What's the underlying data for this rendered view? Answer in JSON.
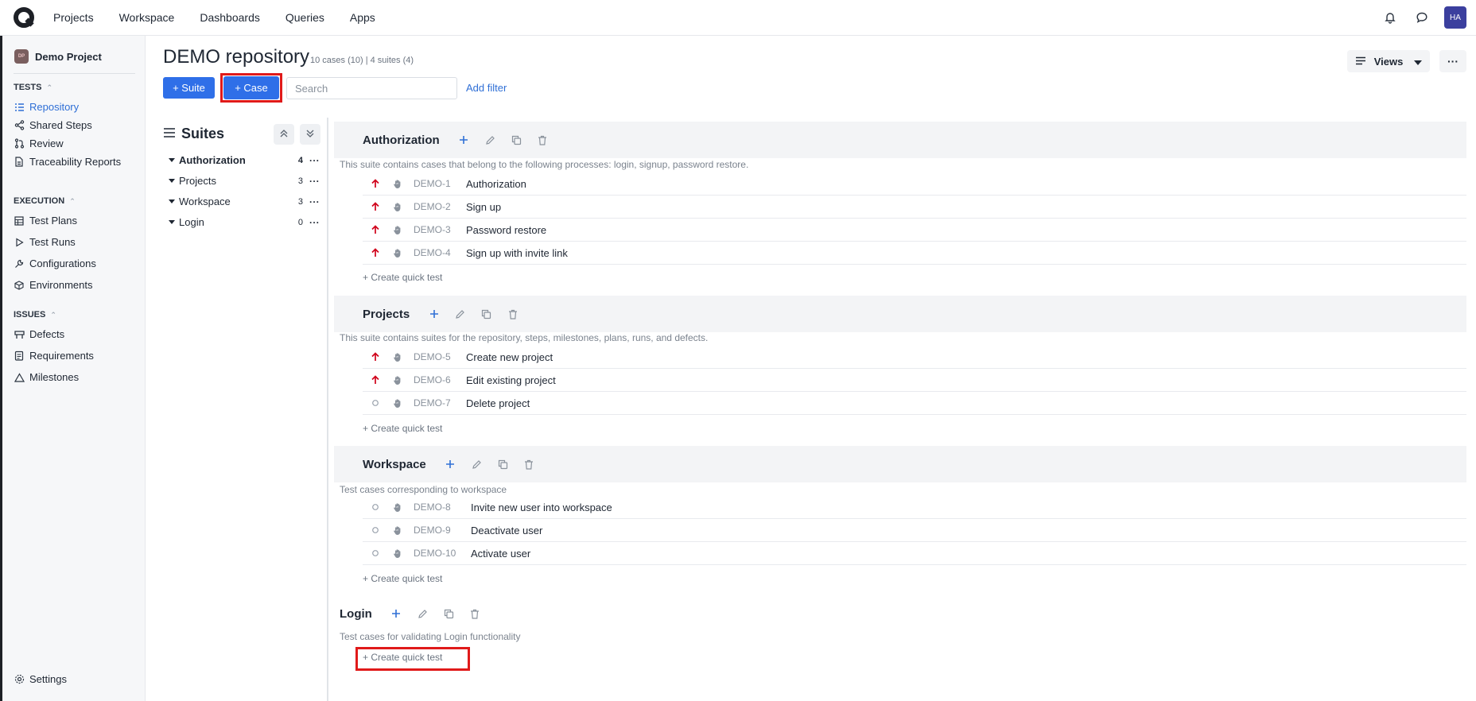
{
  "nav": {
    "links": [
      "Projects",
      "Workspace",
      "Dashboards",
      "Queries",
      "Apps"
    ],
    "avatar": "HA"
  },
  "sidebar": {
    "project_name": "Demo Project",
    "project_initials": "DP",
    "sections": {
      "tests": "TESTS",
      "execution": "EXECUTION",
      "issues": "ISSUES"
    },
    "items": {
      "repository": "Repository",
      "shared_steps": "Shared Steps",
      "review": "Review",
      "traceability": "Traceability Reports",
      "test_plans": "Test Plans",
      "test_runs": "Test Runs",
      "configurations": "Configurations",
      "environments": "Environments",
      "defects": "Defects",
      "requirements": "Requirements",
      "milestones": "Milestones",
      "settings": "Settings"
    }
  },
  "header": {
    "title": "DEMO repository",
    "subtitle": "10 cases (10) | 4 suites (4)",
    "views_label": "Views",
    "more_label": "···"
  },
  "toolbar": {
    "suite_label": "+ Suite",
    "case_label": "+ Case",
    "search_placeholder": "Search",
    "add_filter": "Add filter"
  },
  "tree": {
    "title": "Suites",
    "items": [
      {
        "name": "Authorization",
        "count": "4"
      },
      {
        "name": "Projects",
        "count": "3"
      },
      {
        "name": "Workspace",
        "count": "3"
      },
      {
        "name": "Login",
        "count": "0"
      }
    ]
  },
  "quick_test_label": "+ Create quick test",
  "suites": [
    {
      "name": "Authorization",
      "description": "This suite contains cases that belong to the following processes: login, signup, password restore.",
      "cases": [
        {
          "id": "DEMO-1",
          "title": "Authorization",
          "priority": "high"
        },
        {
          "id": "DEMO-2",
          "title": "Sign up",
          "priority": "high"
        },
        {
          "id": "DEMO-3",
          "title": "Password restore",
          "priority": "high"
        },
        {
          "id": "DEMO-4",
          "title": "Sign up with invite link",
          "priority": "high"
        }
      ]
    },
    {
      "name": "Projects",
      "description": "This suite contains suites for the repository, steps, milestones, plans, runs, and defects.",
      "cases": [
        {
          "id": "DEMO-5",
          "title": "Create new project",
          "priority": "high"
        },
        {
          "id": "DEMO-6",
          "title": "Edit existing project",
          "priority": "high"
        },
        {
          "id": "DEMO-7",
          "title": "Delete project",
          "priority": "none"
        }
      ]
    },
    {
      "name": "Workspace",
      "description": "Test cases corresponding to workspace",
      "cases": [
        {
          "id": "DEMO-8",
          "title": "Invite new user into workspace",
          "priority": "none"
        },
        {
          "id": "DEMO-9",
          "title": "Deactivate user",
          "priority": "none"
        },
        {
          "id": "DEMO-10",
          "title": "Activate user",
          "priority": "none"
        }
      ]
    },
    {
      "name": "Login",
      "description": "Test cases for validating Login functionality",
      "cases": []
    }
  ],
  "colors": {
    "accent": "#2f6fe8",
    "highlight": "#e01a1a",
    "priority_high": "#d0021b"
  }
}
